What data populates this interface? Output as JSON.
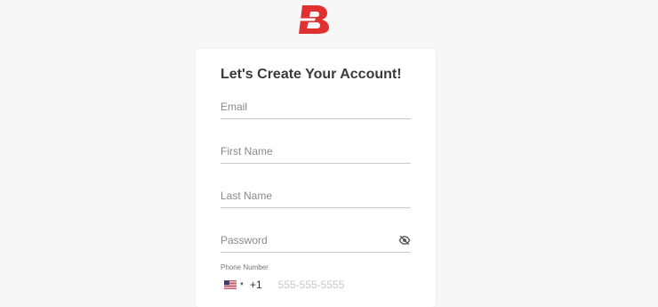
{
  "brand": {
    "logo_icon": "brand-logo-b-icon",
    "color": "#e0302f"
  },
  "form": {
    "title": "Let's Create Your Account!",
    "email": {
      "placeholder": "Email",
      "value": ""
    },
    "first_name": {
      "placeholder": "First Name",
      "value": ""
    },
    "last_name": {
      "placeholder": "Last Name",
      "value": ""
    },
    "password": {
      "placeholder": "Password",
      "value": "",
      "toggle_icon": "eye-slash-icon"
    },
    "phone": {
      "label": "Phone Number",
      "country_flag_icon": "us-flag-icon",
      "dial_code": "+1",
      "placeholder": "555-555-5555",
      "value": ""
    }
  }
}
